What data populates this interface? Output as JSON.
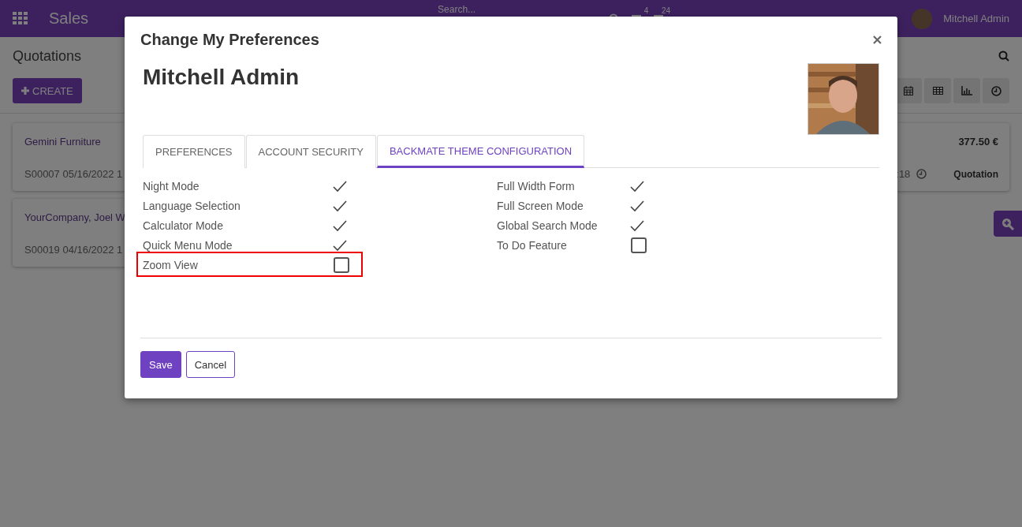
{
  "navbar": {
    "app_name": "Sales",
    "search": {
      "placeholder": "Search..."
    },
    "badges": [
      "4",
      "24"
    ],
    "user": "Mitchell Admin"
  },
  "control_panel": {
    "title": "Quotations",
    "create_label": "CREATE"
  },
  "cards": [
    {
      "customer": "Gemini Furniture",
      "reference": "S00007 05/16/2022 1",
      "time": ":18",
      "amount": "377.50 €",
      "status": "Quotation"
    },
    {
      "customer": "YourCompany, Joel W",
      "reference": "S00019 04/16/2022 1"
    }
  ],
  "dialog": {
    "title": "Change My Preferences",
    "user_name": "Mitchell Admin",
    "tabs": [
      {
        "label": "PREFERENCES",
        "selected": false
      },
      {
        "label": "ACCOUNT SECURITY",
        "selected": false
      },
      {
        "label": "BACKMATE THEME CONFIGURATION",
        "selected": true
      }
    ],
    "options_left": [
      {
        "label": "Night Mode",
        "checked": true,
        "highlighted": false
      },
      {
        "label": "Language Selection",
        "checked": true,
        "highlighted": false
      },
      {
        "label": "Calculator Mode",
        "checked": true,
        "highlighted": false
      },
      {
        "label": "Quick Menu Mode",
        "checked": true,
        "highlighted": false
      },
      {
        "label": "Zoom View",
        "checked": false,
        "highlighted": true
      }
    ],
    "options_right": [
      {
        "label": "Full Width Form",
        "checked": true,
        "highlighted": false
      },
      {
        "label": "Full Screen Mode",
        "checked": true,
        "highlighted": false
      },
      {
        "label": "Global Search Mode",
        "checked": true,
        "highlighted": false
      },
      {
        "label": "To Do Feature",
        "checked": false,
        "highlighted": false
      }
    ],
    "save_label": "Save",
    "cancel_label": "Cancel"
  }
}
